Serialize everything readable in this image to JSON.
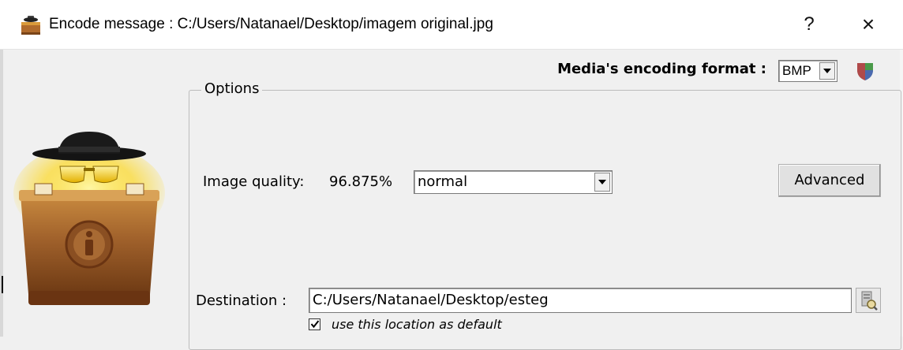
{
  "window": {
    "title": "Encode message : C:/Users/Natanael/Desktop/imagem original.jpg",
    "help_label": "?",
    "close_label": "×",
    "icon": "suitcase-icon"
  },
  "header": {
    "format_label": "Media's encoding format :",
    "format_value": "BMP",
    "format_icon": "shield-icon"
  },
  "options": {
    "legend": "Options",
    "image_quality_label": "Image quality:",
    "image_quality_value": "96.875%",
    "quality_preset": "normal",
    "advanced_label": "Advanced",
    "destination_label": "Destination :",
    "destination_value": "C:/Users/Natanael/Desktop/esteg",
    "browse_icon": "browse-folder-icon",
    "default_checkbox_label": "use this location as default",
    "default_checked": true
  },
  "colors": {
    "window_bg": "#f0f0f0",
    "titlebar_bg": "#ffffff",
    "button_bg": "#e1e1e1",
    "logo_brown": "#a0612b",
    "logo_glow": "#ffd400"
  }
}
